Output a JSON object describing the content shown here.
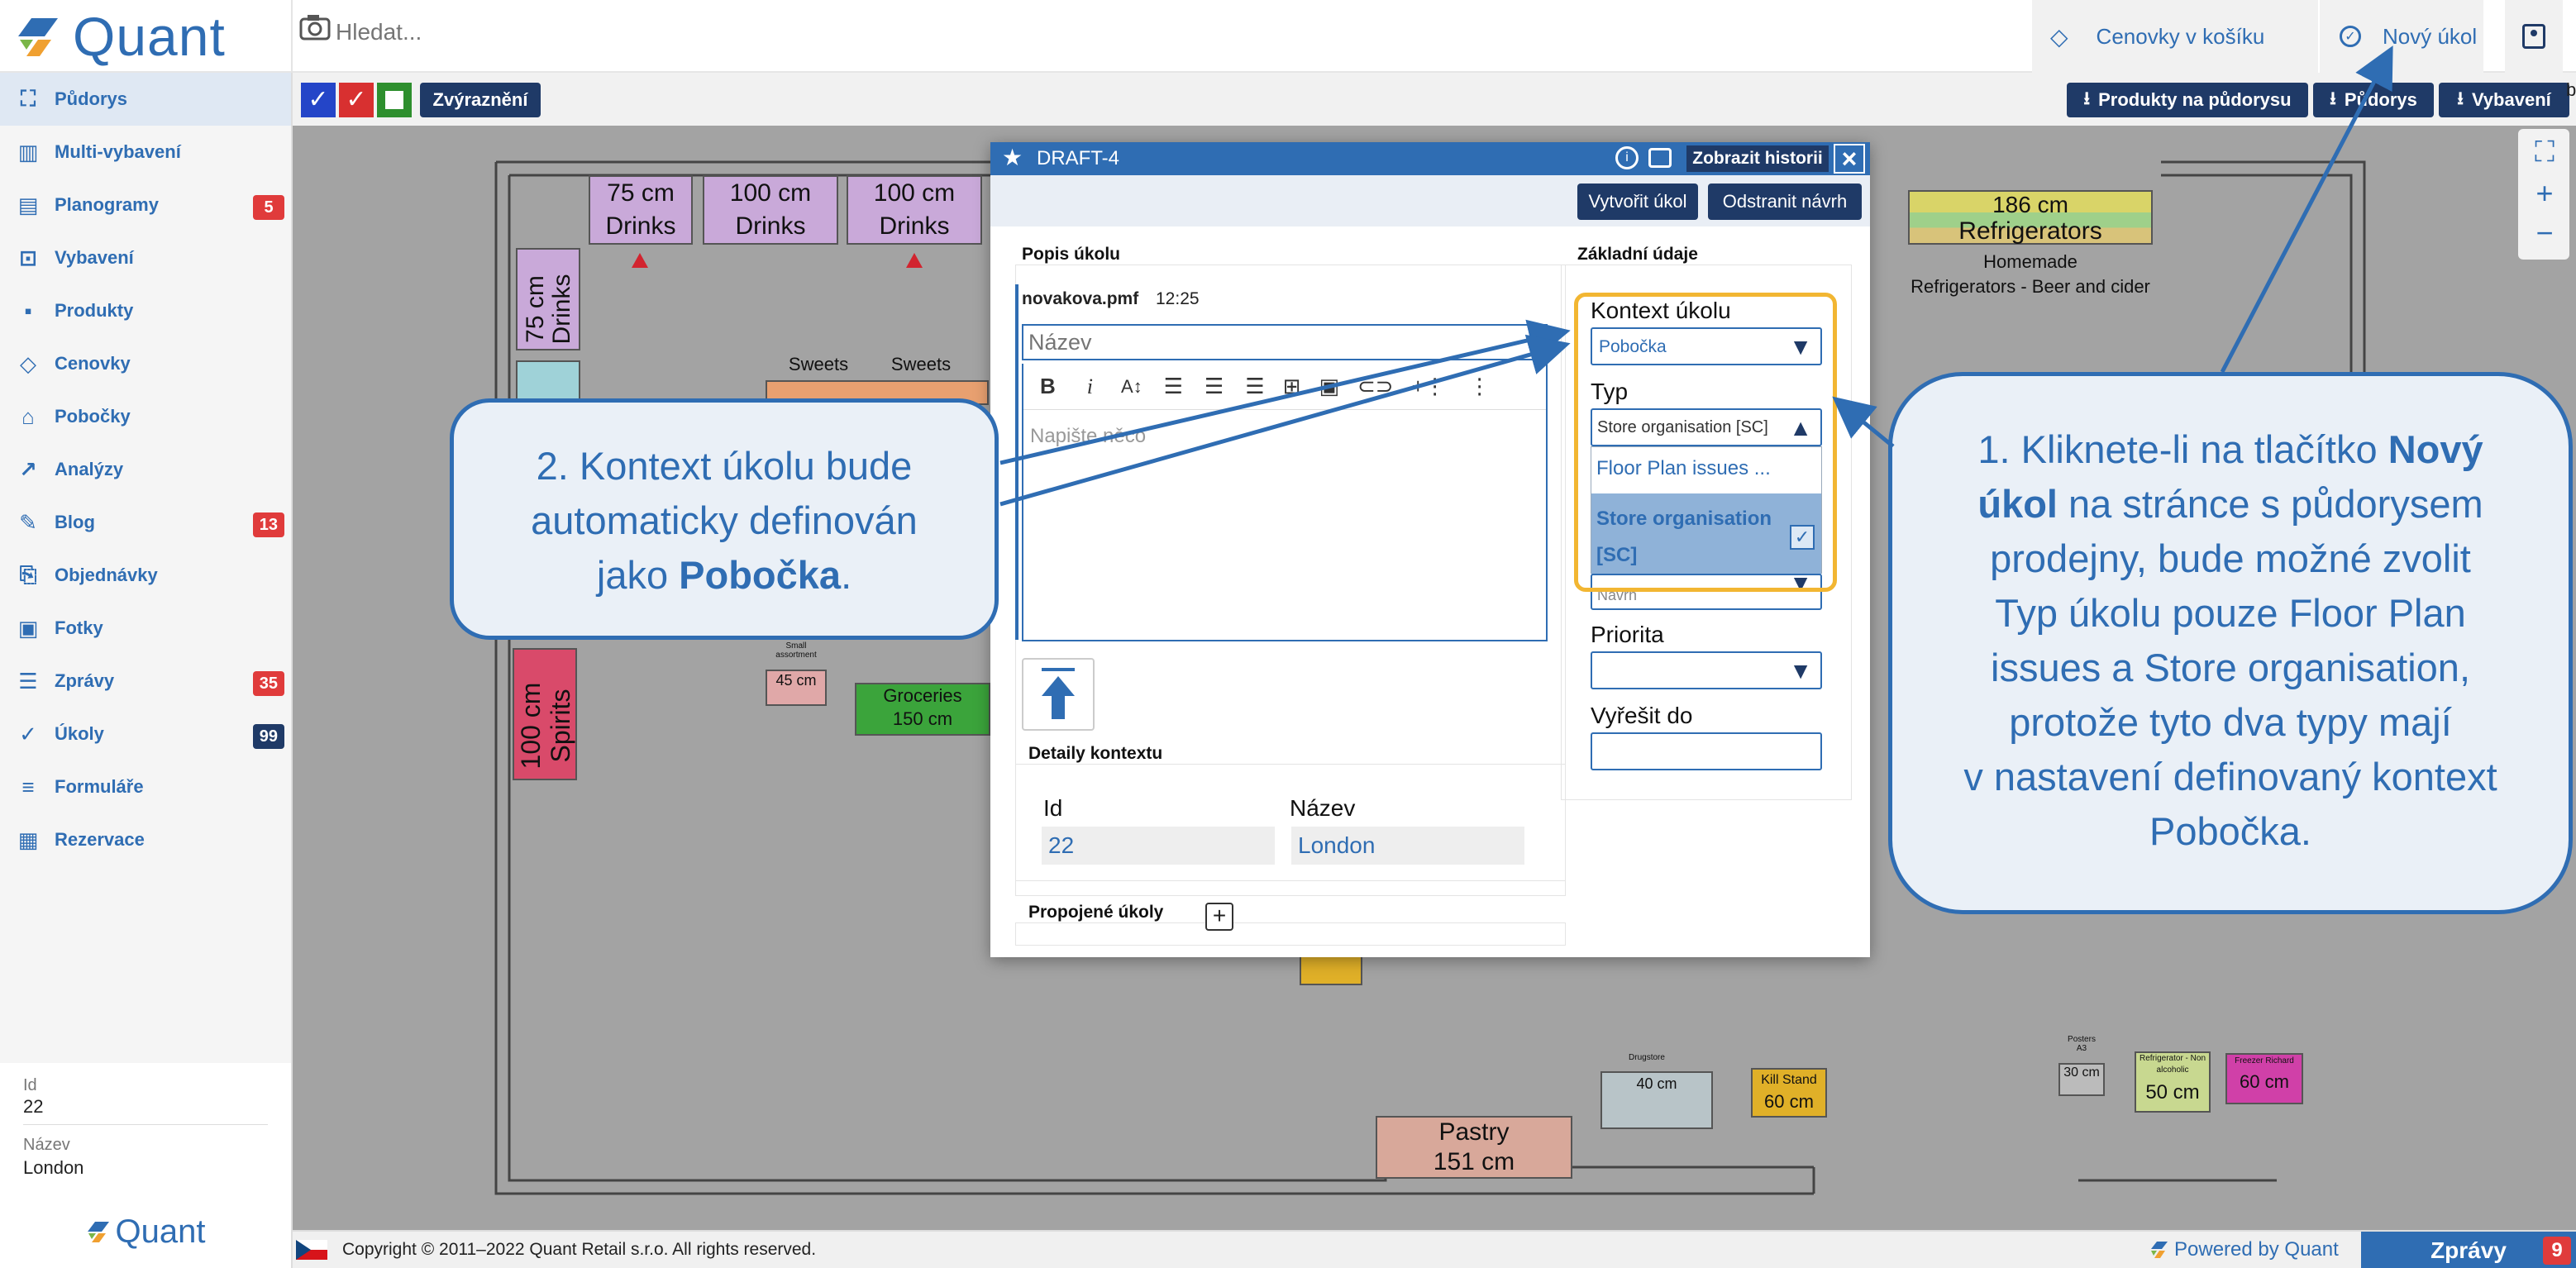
{
  "app": {
    "name": "Quant"
  },
  "search": {
    "placeholder": "Hledat..."
  },
  "topbar": {
    "price_tags_cart": "Cenovky v košíku",
    "new_task": "Nový úkol",
    "edge_letter": "b"
  },
  "sidebar": {
    "items": [
      {
        "label": "Půdorys",
        "icon": "floorplan-icon"
      },
      {
        "label": "Multi-vybavení",
        "icon": "multi-equipment-icon"
      },
      {
        "label": "Planogramy",
        "icon": "planogram-icon",
        "badge": "5"
      },
      {
        "label": "Vybavení",
        "icon": "equipment-icon"
      },
      {
        "label": "Produkty",
        "icon": "products-icon"
      },
      {
        "label": "Cenovky",
        "icon": "price-tag-icon"
      },
      {
        "label": "Pobočky",
        "icon": "branch-icon"
      },
      {
        "label": "Analýzy",
        "icon": "analytics-icon"
      },
      {
        "label": "Blog",
        "icon": "blog-icon",
        "badge": "13"
      },
      {
        "label": "Objednávky",
        "icon": "orders-icon"
      },
      {
        "label": "Fotky",
        "icon": "photos-icon"
      },
      {
        "label": "Zprávy",
        "icon": "messages-icon",
        "badge": "35"
      },
      {
        "label": "Úkoly",
        "icon": "tasks-icon",
        "badge": "99"
      },
      {
        "label": "Formuláře",
        "icon": "forms-icon"
      },
      {
        "label": "Rezervace",
        "icon": "reservations-icon"
      }
    ],
    "info": {
      "id_label": "Id",
      "id_value": "22",
      "name_label": "Název",
      "name_value": "London"
    },
    "footer_logo": "Quant"
  },
  "toolbar": {
    "highlight": "Zvýraznění",
    "products_on_floorplan": "Produkty na půdorysu",
    "floorplan": "Půdorys",
    "equipment": "Vybavení"
  },
  "floorplan": {
    "items": [
      {
        "name": "75 cm",
        "sub": "Drinks"
      },
      {
        "name": "100 cm",
        "sub": "Drinks"
      },
      {
        "name": "100 cm",
        "sub": "Drinks"
      },
      {
        "name": "75 cm",
        "sub": "Drinks"
      },
      {
        "name": "186 cm",
        "sub": "Refrigerators"
      },
      {
        "name": "100 cm",
        "sub": "Spirits"
      },
      {
        "name": "Pastry",
        "sub": "151 cm"
      }
    ],
    "labels": {
      "homemade": "Homemade",
      "refrigerators_beer": "Refrigerators - Beer and cider",
      "sweets1": "Sweets",
      "sweets2": "Sweets",
      "small_assortment": "Small assortment",
      "small_45": "45 cm",
      "groceries": "Groceries",
      "groceries_size": "150 cm",
      "drugstore": "Drugstore",
      "drugstore_40": "40 cm",
      "kill_stand": "Kill Stand",
      "kill_60": "60 cm",
      "posters": "Posters A3",
      "posters_30": "30 cm",
      "fridge_nonalc": "Refrigerator - Non alcoholic",
      "fridge_50": "50 cm",
      "freezer": "Freezer Richard",
      "freezer_60": "60 cm"
    }
  },
  "dialog": {
    "title": "DRAFT-4",
    "history_btn": "Zobrazit historii",
    "create_btn": "Vytvořit úkol",
    "remove_btn": "Odstranit návrh",
    "desc_section": "Popis úkolu",
    "author": "novakova.pmf",
    "time": "12:25",
    "name_placeholder": "Název",
    "editor_placeholder": "Napište něco",
    "context_section": "Detaily kontextu",
    "ctx_id_label": "Id",
    "ctx_id_value": "22",
    "ctx_name_label": "Název",
    "ctx_name_value": "London",
    "linked_section": "Propojené úkoly",
    "basic_section": "Základní údaje",
    "ctx_label": "Kontext úkolu",
    "ctx_value": "Pobočka",
    "type_label": "Typ",
    "type_value": "Store organisation [SC]",
    "type_options": [
      "Floor Plan issues ...",
      "Store organisation",
      "[SC]"
    ],
    "status_value": "Návrh",
    "priority_label": "Priorita",
    "due_label": "Vyřešit do"
  },
  "callouts": {
    "left": {
      "text1": "2. Kontext úkolu bude",
      "text2": "automaticky definován",
      "text3": "jako ",
      "bold": "Pobočka",
      "end": "."
    },
    "right": {
      "l1a": "1. Kliknete-li na tlačítko ",
      "l1b": "Nový",
      "l2a": "úkol",
      "l2b": " na stránce s půdorysem",
      "l3": "prodejny, bude možné zvolit",
      "l4": "Typ úkolu pouze Floor Plan",
      "l5": "issues a Store organisation,",
      "l6": "protože tyto dva typy mají",
      "l7": "v nastavení definovaný kontext",
      "l8": "Pobočka."
    }
  },
  "footer": {
    "copyright": "Copyright © 2011–2022 Quant Retail s.r.o. All rights reserved.",
    "powered": "Powered by Quant",
    "messages": "Zprávy",
    "messages_count": "9"
  },
  "colors": {
    "brand": "#2f6db3",
    "navy": "#1f3a67",
    "badge_red": "#e03b3b",
    "badge_navy": "#1f3a67",
    "highlight": "#f2b632"
  }
}
